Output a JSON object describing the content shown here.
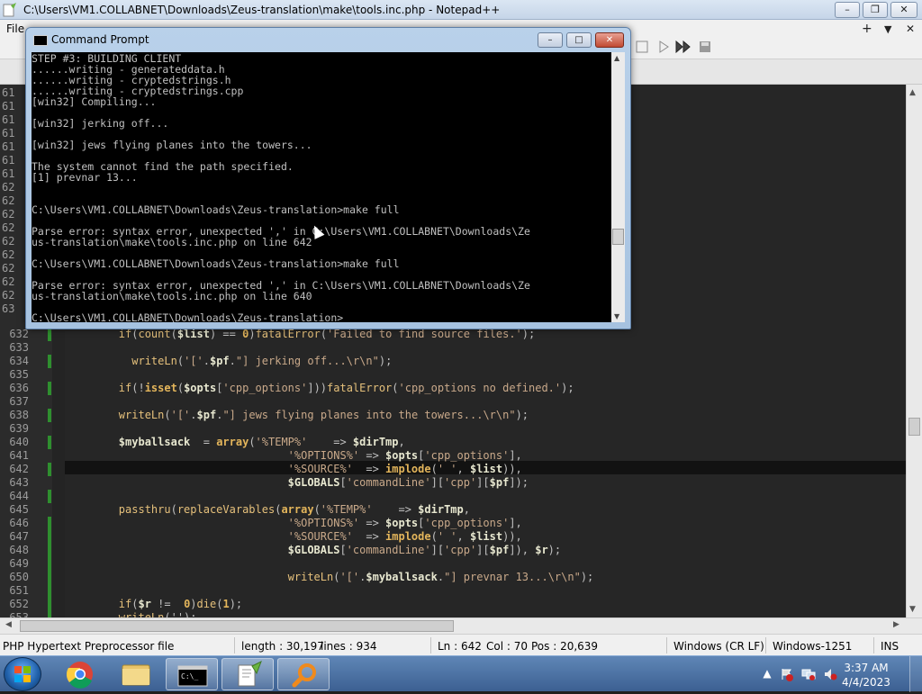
{
  "notepad": {
    "title": "C:\\Users\\VM1.COLLABNET\\Downloads\\Zeus-translation\\make\\tools.inc.php - Notepad++",
    "menu_first": "File",
    "window_buttons": {
      "minimize": "–",
      "maximize": "❐",
      "close": "✕"
    },
    "menu_right": {
      "add_tab": "+",
      "dropdown": "▼",
      "close_tab": "✕"
    }
  },
  "hidden_gutter": [
    "61",
    "61",
    "61",
    "61",
    "61",
    "61",
    "61",
    "62",
    "62",
    "62",
    "62",
    "62",
    "62",
    "62",
    "62",
    "62",
    "63"
  ],
  "editor_lines": [
    {
      "num": "632",
      "segments": [
        [
          "ind",
          "        "
        ],
        [
          "fn",
          "if"
        ],
        [
          "op",
          "("
        ],
        [
          "fn",
          "count"
        ],
        [
          "op",
          "("
        ],
        [
          "var",
          "$list"
        ],
        [
          "op",
          ") == "
        ],
        [
          "kw",
          "0"
        ],
        [
          "op",
          ")"
        ],
        [
          "fn",
          "fatalError"
        ],
        [
          "op",
          "("
        ],
        [
          "str",
          "'Failed to find source files.'"
        ],
        [
          "op",
          ");"
        ]
      ]
    },
    {
      "num": "633",
      "segments": []
    },
    {
      "num": "634",
      "segments": [
        [
          "ind",
          "          "
        ],
        [
          "fn",
          "writeLn"
        ],
        [
          "op",
          "("
        ],
        [
          "str",
          "'['"
        ],
        [
          "op",
          "."
        ],
        [
          "var",
          "$pf"
        ],
        [
          "op",
          "."
        ],
        [
          "str",
          "\"] jerking off...\\r\\n\""
        ],
        [
          "op",
          ");"
        ]
      ]
    },
    {
      "num": "635",
      "segments": []
    },
    {
      "num": "636",
      "segments": [
        [
          "ind",
          "        "
        ],
        [
          "fn",
          "if"
        ],
        [
          "op",
          "(!"
        ],
        [
          "kw",
          "isset"
        ],
        [
          "op",
          "("
        ],
        [
          "var",
          "$opts"
        ],
        [
          "op",
          "["
        ],
        [
          "str",
          "'cpp_options'"
        ],
        [
          "op",
          "]))"
        ],
        [
          "fn",
          "fatalError"
        ],
        [
          "op",
          "("
        ],
        [
          "str",
          "'cpp_options no defined.'"
        ],
        [
          "op",
          ");"
        ]
      ]
    },
    {
      "num": "637",
      "segments": []
    },
    {
      "num": "638",
      "segments": [
        [
          "ind",
          "        "
        ],
        [
          "fn",
          "writeLn"
        ],
        [
          "op",
          "("
        ],
        [
          "str",
          "'['"
        ],
        [
          "op",
          "."
        ],
        [
          "var",
          "$pf"
        ],
        [
          "op",
          "."
        ],
        [
          "str",
          "\"] jews flying planes into the towers...\\r\\n\""
        ],
        [
          "op",
          ");"
        ]
      ]
    },
    {
      "num": "639",
      "segments": []
    },
    {
      "num": "640",
      "segments": [
        [
          "ind",
          "        "
        ],
        [
          "var",
          "$myballsack"
        ],
        [
          "op",
          "  = "
        ],
        [
          "kw",
          "array"
        ],
        [
          "op",
          "("
        ],
        [
          "str",
          "'%TEMP%'"
        ],
        [
          "op",
          "    => "
        ],
        [
          "var",
          "$dirTmp"
        ],
        [
          "op",
          ","
        ]
      ]
    },
    {
      "num": "641",
      "segments": [
        [
          "ind",
          "                                  "
        ],
        [
          "str",
          "'%OPTIONS%'"
        ],
        [
          "op",
          " => "
        ],
        [
          "var",
          "$opts"
        ],
        [
          "op",
          "["
        ],
        [
          "str",
          "'cpp_options'"
        ],
        [
          "op",
          "],"
        ]
      ]
    },
    {
      "num": "642",
      "segments": [
        [
          "ind",
          "                                  "
        ],
        [
          "str",
          "'%SOURCE%'"
        ],
        [
          "op",
          "  => "
        ],
        [
          "kw",
          "implode"
        ],
        [
          "op",
          "("
        ],
        [
          "str",
          "' '"
        ],
        [
          "op",
          ", "
        ],
        [
          "var",
          "$list"
        ],
        [
          "op",
          ")),"
        ]
      ]
    },
    {
      "num": "643",
      "segments": [
        [
          "ind",
          "                                  "
        ],
        [
          "var",
          "$GLOBALS"
        ],
        [
          "op",
          "["
        ],
        [
          "str",
          "'commandLine'"
        ],
        [
          "op",
          "]["
        ],
        [
          "str",
          "'cpp'"
        ],
        [
          "op",
          "]["
        ],
        [
          "var",
          "$pf"
        ],
        [
          "op",
          "]);"
        ]
      ]
    },
    {
      "num": "644",
      "segments": []
    },
    {
      "num": "645",
      "segments": [
        [
          "ind",
          "        "
        ],
        [
          "fn",
          "passthru"
        ],
        [
          "op",
          "("
        ],
        [
          "fn",
          "replaceVarables"
        ],
        [
          "op",
          "("
        ],
        [
          "kw",
          "array"
        ],
        [
          "op",
          "("
        ],
        [
          "str",
          "'%TEMP%'"
        ],
        [
          "op",
          "    => "
        ],
        [
          "var",
          "$dirTmp"
        ],
        [
          "op",
          ","
        ]
      ]
    },
    {
      "num": "646",
      "segments": [
        [
          "ind",
          "                                  "
        ],
        [
          "str",
          "'%OPTIONS%'"
        ],
        [
          "op",
          " => "
        ],
        [
          "var",
          "$opts"
        ],
        [
          "op",
          "["
        ],
        [
          "str",
          "'cpp_options'"
        ],
        [
          "op",
          "],"
        ]
      ]
    },
    {
      "num": "647",
      "segments": [
        [
          "ind",
          "                                  "
        ],
        [
          "str",
          "'%SOURCE%'"
        ],
        [
          "op",
          "  => "
        ],
        [
          "kw",
          "implode"
        ],
        [
          "op",
          "("
        ],
        [
          "str",
          "' '"
        ],
        [
          "op",
          ", "
        ],
        [
          "var",
          "$list"
        ],
        [
          "op",
          ")),"
        ]
      ]
    },
    {
      "num": "648",
      "segments": [
        [
          "ind",
          "                                  "
        ],
        [
          "var",
          "$GLOBALS"
        ],
        [
          "op",
          "["
        ],
        [
          "str",
          "'commandLine'"
        ],
        [
          "op",
          "]["
        ],
        [
          "str",
          "'cpp'"
        ],
        [
          "op",
          "]["
        ],
        [
          "var",
          "$pf"
        ],
        [
          "op",
          "]), "
        ],
        [
          "var",
          "$r"
        ],
        [
          "op",
          ");"
        ]
      ]
    },
    {
      "num": "649",
      "segments": []
    },
    {
      "num": "650",
      "segments": [
        [
          "ind",
          "                                  "
        ],
        [
          "fn",
          "writeLn"
        ],
        [
          "op",
          "("
        ],
        [
          "str",
          "'['"
        ],
        [
          "op",
          "."
        ],
        [
          "var",
          "$myballsack"
        ],
        [
          "op",
          "."
        ],
        [
          "str",
          "\"] prevnar 13...\\r\\n\""
        ],
        [
          "op",
          ");"
        ]
      ]
    },
    {
      "num": "651",
      "segments": []
    },
    {
      "num": "652",
      "segments": [
        [
          "ind",
          "        "
        ],
        [
          "fn",
          "if"
        ],
        [
          "op",
          "("
        ],
        [
          "var",
          "$r"
        ],
        [
          "op",
          " !=  "
        ],
        [
          "kw",
          "0"
        ],
        [
          "op",
          ")"
        ],
        [
          "fn",
          "die"
        ],
        [
          "op",
          "("
        ],
        [
          "kw",
          "1"
        ],
        [
          "op",
          ");"
        ]
      ]
    },
    {
      "num": "653",
      "segments": [
        [
          "ind",
          "        "
        ],
        [
          "fn",
          "writeLn"
        ],
        [
          "op",
          "('');"
        ]
      ]
    }
  ],
  "cmd": {
    "title": "Command Prompt",
    "buttons": {
      "minimize": "–",
      "maximize": "□",
      "close": "✕"
    },
    "lines": [
      "STEP #3: BUILDING CLIENT",
      "......writing - generateddata.h",
      "......writing - cryptedstrings.h",
      "......writing - cryptedstrings.cpp",
      "[win32] Compiling...",
      "",
      "[win32] jerking off...",
      "",
      "[win32] jews flying planes into the towers...",
      "",
      "The system cannot find the path specified.",
      "[1] prevnar 13...",
      "",
      "",
      "C:\\Users\\VM1.COLLABNET\\Downloads\\Zeus-translation>make full",
      "",
      "Parse error: syntax error, unexpected ',' in C:\\Users\\VM1.COLLABNET\\Downloads\\Ze",
      "us-translation\\make\\tools.inc.php on line 642",
      "",
      "C:\\Users\\VM1.COLLABNET\\Downloads\\Zeus-translation>make full",
      "",
      "Parse error: syntax error, unexpected ',' in C:\\Users\\VM1.COLLABNET\\Downloads\\Ze",
      "us-translation\\make\\tools.inc.php on line 640",
      "",
      "C:\\Users\\VM1.COLLABNET\\Downloads\\Zeus-translation>_"
    ]
  },
  "status": {
    "file_type": "PHP Hypertext Preprocessor file",
    "length": "length : 30,197",
    "lines": "lines : 934",
    "ln": "Ln : 642",
    "col": "Col : 70",
    "pos": "Pos : 20,639",
    "eol": "Windows (CR LF)",
    "encoding": "Windows-1251",
    "mode": "INS"
  },
  "taskbar": {
    "time": "3:37 AM",
    "date": "4/4/2023",
    "apps": [
      "chrome-icon",
      "explorer-icon",
      "cmd-icon",
      "notepadpp-icon",
      "search-app-icon"
    ]
  },
  "colors": {
    "editor_bg": "#262626",
    "keyword": "#e3b55b",
    "string": "#c9a98a",
    "change_bar": "#2f8f2f"
  }
}
